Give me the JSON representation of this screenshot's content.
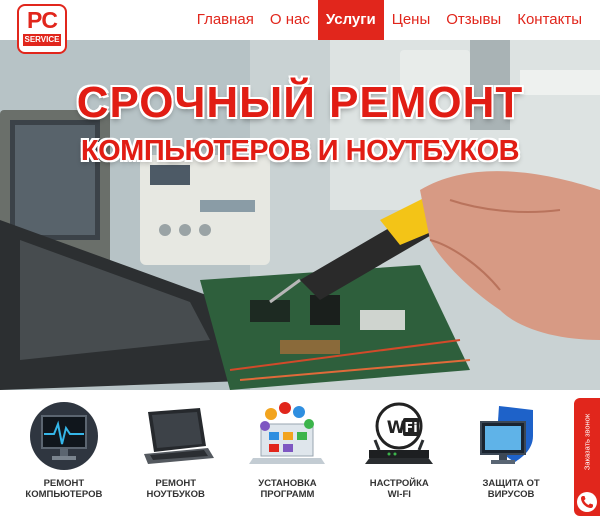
{
  "logo": {
    "pc": "PC",
    "service": "SERVICE"
  },
  "nav": {
    "items": [
      {
        "label": "Главная"
      },
      {
        "label": "О нас"
      },
      {
        "label": "Услуги"
      },
      {
        "label": "Цены"
      },
      {
        "label": "Отзывы"
      },
      {
        "label": "Контакты"
      }
    ],
    "active_index": 2
  },
  "hero": {
    "title": "СРОЧНЫЙ РЕМОНТ",
    "subtitle": "КОМПЬЮТЕРОВ И НОУТБУКОВ"
  },
  "services": [
    {
      "label": "Ремонт\nкомпьютеров",
      "icon": "monitor-icon"
    },
    {
      "label": "Ремонт\nноутбуков",
      "icon": "laptop-icon"
    },
    {
      "label": "Установка\nпрограмм",
      "icon": "apps-laptop-icon"
    },
    {
      "label": "Настройка\nWi-Fi",
      "icon": "wifi-router-icon"
    },
    {
      "label": "Защита от\nвирусов",
      "icon": "shield-monitor-icon"
    }
  ],
  "callback": {
    "label": "Заказать звонок",
    "icon": "phone-icon"
  },
  "colors": {
    "accent": "#e1261c",
    "text": "#333333"
  }
}
